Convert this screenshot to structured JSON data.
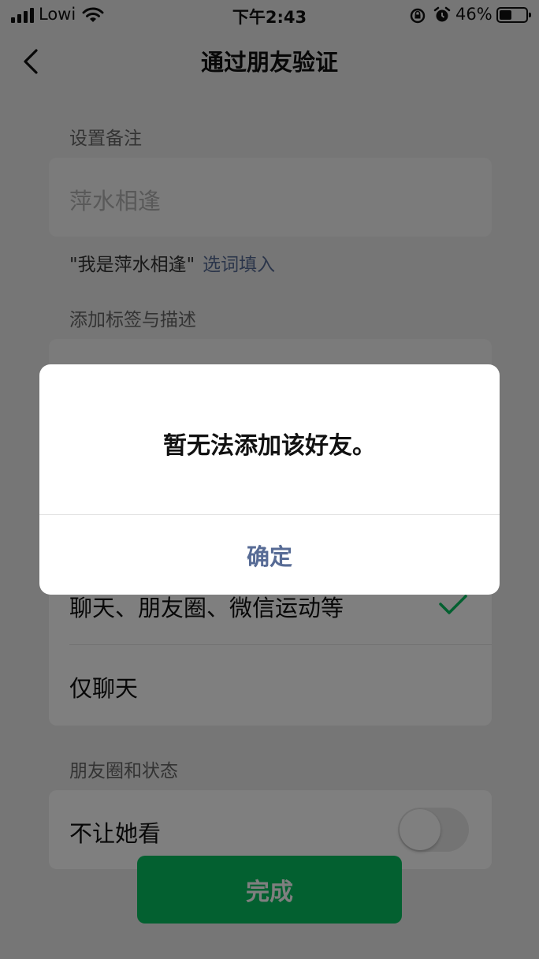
{
  "status_bar": {
    "carrier": "Lowi",
    "time": "下午2:43",
    "battery_percent": "46%",
    "battery_level": 0.46
  },
  "nav": {
    "title": "通过朋友验证"
  },
  "remark": {
    "label": "设置备注",
    "placeholder": "萍水相逢",
    "hint_quote": "\"我是萍水相逢\"",
    "hint_link": "选词填入"
  },
  "tags": {
    "label": "添加标签与描述"
  },
  "permissions": {
    "options": [
      {
        "label": "聊天、朋友圈、微信运动等",
        "selected": true
      },
      {
        "label": "仅聊天",
        "selected": false
      }
    ]
  },
  "moments": {
    "label": "朋友圈和状态",
    "option_label": "不让她看",
    "enabled": false
  },
  "done_button": "完成",
  "dialog": {
    "message": "暂无法添加该好友。",
    "confirm": "确定"
  },
  "colors": {
    "accent_green": "#07c160",
    "link_blue": "#576b95",
    "background": "#ededed"
  }
}
